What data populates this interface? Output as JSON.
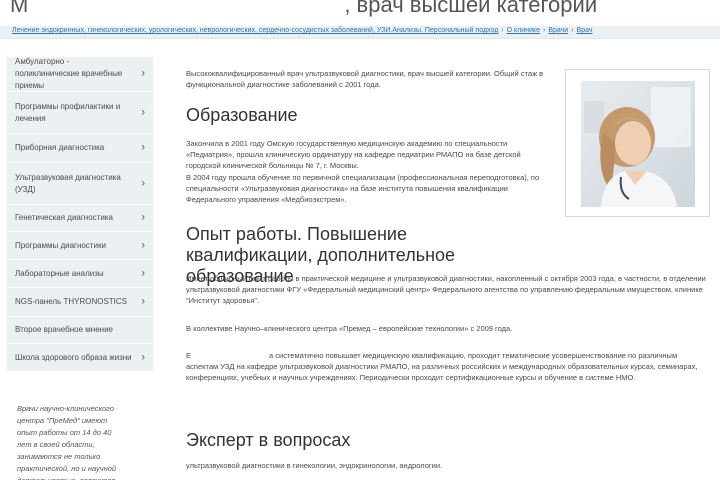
{
  "header": {
    "title_prefix": "М",
    "title_suffix": ", врач высшей категории"
  },
  "breadcrumb": {
    "items": [
      "Лечение эндокринных, гинекологических, урологических, неврологических, сердечно-сосудистых заболеваний, УЗИ.Анализы. Персональный подход",
      "О клинике",
      "Врачи",
      "Врач"
    ],
    "separator": "›"
  },
  "sidebar": {
    "items": [
      {
        "label": "Амбулаторно - поликлинические врачебные приемы"
      },
      {
        "label": "Программы профилактики и лечения"
      },
      {
        "label": "Приборная диагностика"
      },
      {
        "label": "Ультразвуковая диагностика (УЗД)"
      },
      {
        "label": "Генетическая диагностика"
      },
      {
        "label": "Программы диагностики"
      },
      {
        "label": "Лабораторные анализы"
      },
      {
        "label": "NGS-панель THYRONOSTICS"
      },
      {
        "label": "Второе врачебное мнение"
      },
      {
        "label": "Школа здорового образа жизни"
      }
    ],
    "chevron": "›",
    "note": "Врачи научно-клинического центра \"ПреМед\" имеют опыт работы от 14 до 40 лет в своей области, занимаются не только практической, но и научной деятельностью, являются"
  },
  "main": {
    "intro": "Высококвалифицированный врач ультразвуковой диагностики, врач высшей категории. Общий стаж в функциональной диагностике заболеваний с 2001 года.",
    "education_heading": "Образование",
    "education_text": "Закончила в 2001 году Омскую государственную медицинскую академию по специальности «Педиатрия», прошла клиническую ординатуру на кафедре педиатрии РМАПО на базе детской городской клинической больницы № 7, г. Москвы.",
    "education_text2": "В 2004 году прошла обучение по первичной специализации (профессиональная переподготовка), по специальности «Ультразвуковая диагностика» на базе института повышения квалификации Федерального управления «Медбиоэкстрем».",
    "experience_heading": "Опыт работы. Повышение квалификации, дополнительное образование",
    "experience_text": "Имеет обширный опыт работы в практической медицине и ультразвуковой диагностики, накопленный с октября 2003 года, в частности, в отделении ультразвуковой диагностики ФГУ «Федеральный медицинский центр» Федерального агентства по управлению федеральным имуществом, клинике \"Институт здоровья\".",
    "collective_text": "В коллективе Научно–клинического центра «Премед – европейские технологии» с 2009 года.",
    "qualification_prefix": "Е",
    "qualification_text": "а систематично повышает медицинскую квалификацию, проходит тематические усовершенствование по различным аспектам УЗД на кафедре ультразвуковой диагностики РМАПО, на различных российских и международных образовательных курсах, семинарах, конференциях, учебных и научных учреждениях. Периодически проходит сертификационные курсы и обучение в системе НМО.",
    "expert_heading": "Эксперт в вопросах",
    "expert_text": "ультразвуковой диагностики в гинекологии, эндокринологии, андрологии."
  }
}
